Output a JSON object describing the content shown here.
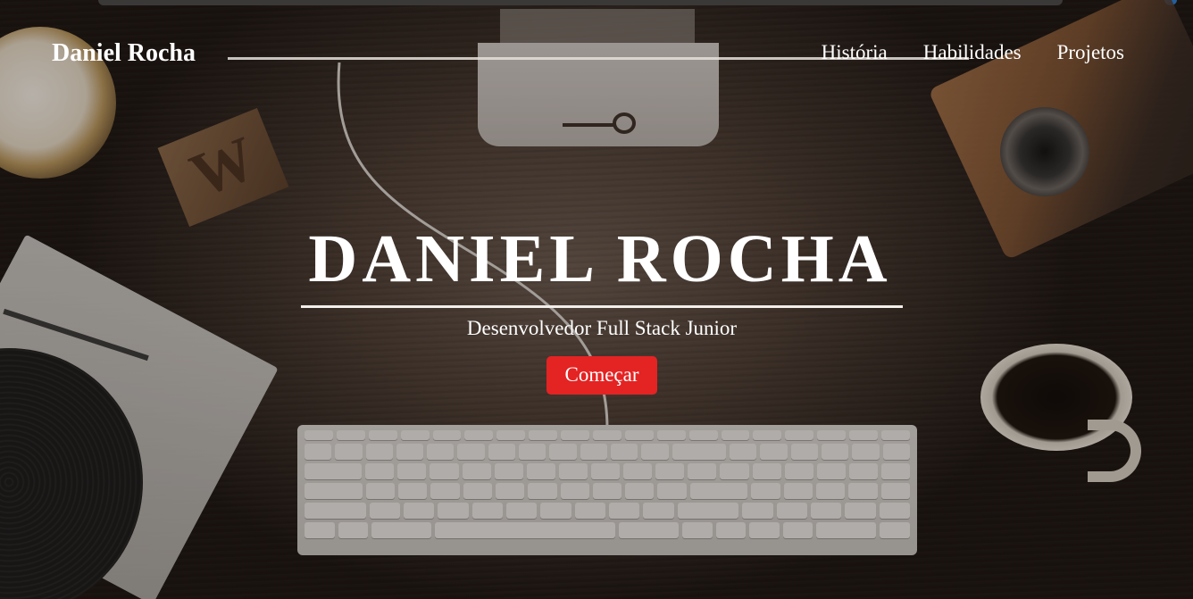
{
  "nav": {
    "brand": "Daniel Rocha",
    "links": [
      {
        "label": "História"
      },
      {
        "label": "Habilidades"
      },
      {
        "label": "Projetos"
      }
    ]
  },
  "hero": {
    "title": "DANIEL ROCHA",
    "subtitle": "Desenvolvedor Full Stack Junior",
    "cta_label": "Começar"
  },
  "colors": {
    "cta_background": "#e42323",
    "text": "#ffffff"
  },
  "background": {
    "w_block_letter": "W"
  }
}
